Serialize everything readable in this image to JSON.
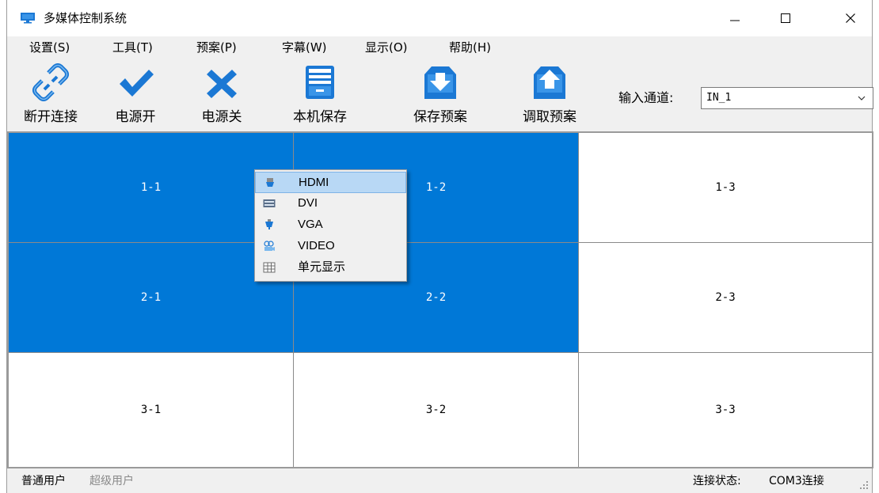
{
  "window": {
    "title": "多媒体控制系统",
    "controls": {
      "minimize": "—",
      "maximize": "☐",
      "close": "✕"
    }
  },
  "menu": {
    "items": [
      "设置(S)",
      "工具(T)",
      "预案(P)",
      "字幕(W)",
      "显示(O)",
      "帮助(H)"
    ]
  },
  "toolbar": {
    "buttons": [
      {
        "label": "断开连接",
        "icon": "link-icon"
      },
      {
        "label": "电源开",
        "icon": "check-icon"
      },
      {
        "label": "电源关",
        "icon": "x-icon"
      },
      {
        "label": "本机保存",
        "icon": "drawer-save-icon"
      },
      {
        "label": "保存预案",
        "icon": "tray-download-icon"
      },
      {
        "label": "调取预案",
        "icon": "tray-upload-icon"
      }
    ],
    "channel_label": "输入通道:",
    "channel_value": "IN_1"
  },
  "grid": {
    "rows": 3,
    "cols": 3,
    "cells": [
      {
        "label": "1-1",
        "selected": true
      },
      {
        "label": "1-2",
        "selected": true
      },
      {
        "label": "1-3",
        "selected": false
      },
      {
        "label": "2-1",
        "selected": true
      },
      {
        "label": "2-2",
        "selected": true
      },
      {
        "label": "2-3",
        "selected": false
      },
      {
        "label": "3-1",
        "selected": false
      },
      {
        "label": "3-2",
        "selected": false
      },
      {
        "label": "3-3",
        "selected": false
      }
    ],
    "selected_color": "#0078d7"
  },
  "context_menu": {
    "items": [
      {
        "label": "HDMI",
        "icon": "hdmi-plug-icon",
        "highlighted": true
      },
      {
        "label": "DVI",
        "icon": "dvi-port-icon",
        "highlighted": false
      },
      {
        "label": "VGA",
        "icon": "vga-plug-icon",
        "highlighted": false
      },
      {
        "label": "VIDEO",
        "icon": "video-camera-icon",
        "highlighted": false
      },
      {
        "label": "单元显示",
        "icon": "grid-table-icon",
        "highlighted": false
      }
    ]
  },
  "statusbar": {
    "user": "普通用户",
    "super_user": "超级用户",
    "connection_label": "连接状态:",
    "connection_value": "COM3连接"
  },
  "colors": {
    "accent": "#0078d7",
    "icon_blue": "#1b78d4",
    "menu_highlight": "#b8d8f5"
  }
}
